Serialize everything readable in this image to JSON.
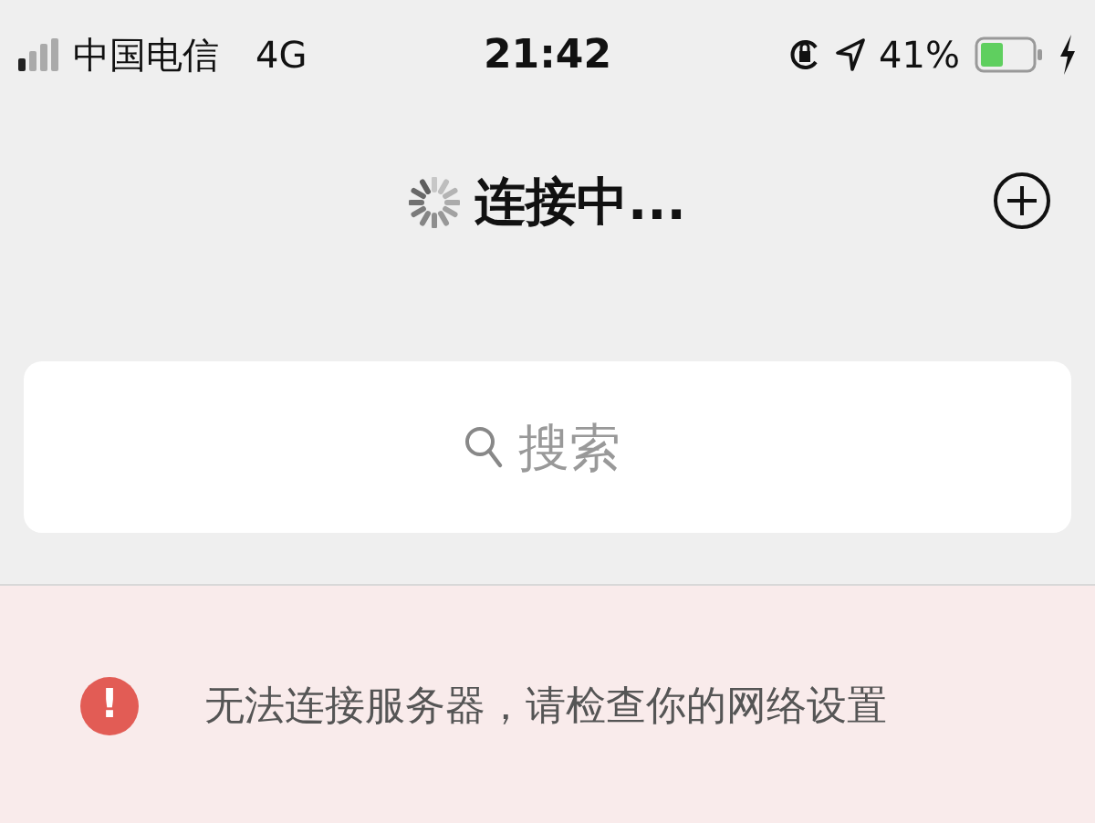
{
  "status_bar": {
    "carrier": "中国电信",
    "network": "4G",
    "time": "21:42",
    "battery": "41%"
  },
  "nav_bar": {
    "title": "连接中..."
  },
  "search": {
    "placeholder": "搜索"
  },
  "error_banner": {
    "icon": "!",
    "message": "无法连接服务器，请检查你的网络设置"
  }
}
